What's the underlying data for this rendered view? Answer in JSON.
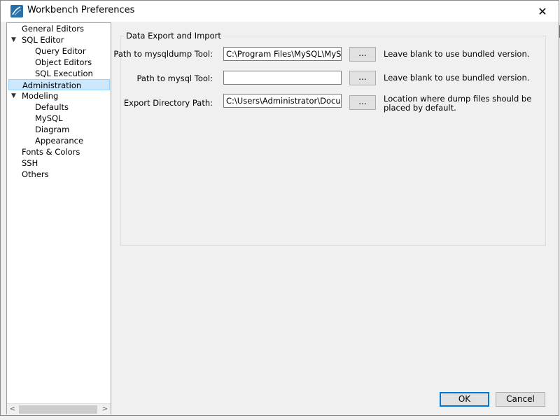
{
  "window": {
    "title": "Workbench Preferences",
    "close_label": "✕"
  },
  "tree": {
    "items": [
      {
        "label": "General Editors"
      },
      {
        "label": "SQL Editor",
        "arrow": "▼"
      },
      {
        "label": "Query Editor"
      },
      {
        "label": "Object Editors"
      },
      {
        "label": "SQL Execution"
      },
      {
        "label": "Administration"
      },
      {
        "label": "Modeling",
        "arrow": "▼"
      },
      {
        "label": "Defaults"
      },
      {
        "label": "MySQL"
      },
      {
        "label": "Diagram"
      },
      {
        "label": "Appearance"
      },
      {
        "label": "Fonts & Colors"
      },
      {
        "label": "SSH"
      },
      {
        "label": "Others"
      }
    ],
    "scroll_left": "<",
    "scroll_right": ">"
  },
  "section": {
    "title": "Data Export and Import",
    "rows": [
      {
        "label": "Path to mysqldump Tool:",
        "value": "C:\\Program Files\\MySQL\\MySQL Se",
        "button": "...",
        "hint": "Leave blank to use bundled version."
      },
      {
        "label": "Path to mysql Tool:",
        "value": "",
        "button": "...",
        "hint": "Leave blank to use bundled version."
      },
      {
        "label": "Export Directory Path:",
        "value": "C:\\Users\\Administrator\\Documents",
        "button": "...",
        "hint": "Location where dump files should be placed by default."
      }
    ]
  },
  "footer": {
    "ok": "OK",
    "cancel": "Cancel"
  },
  "colors": {
    "selection": "#cce8ff",
    "accent": "#0078d7"
  }
}
